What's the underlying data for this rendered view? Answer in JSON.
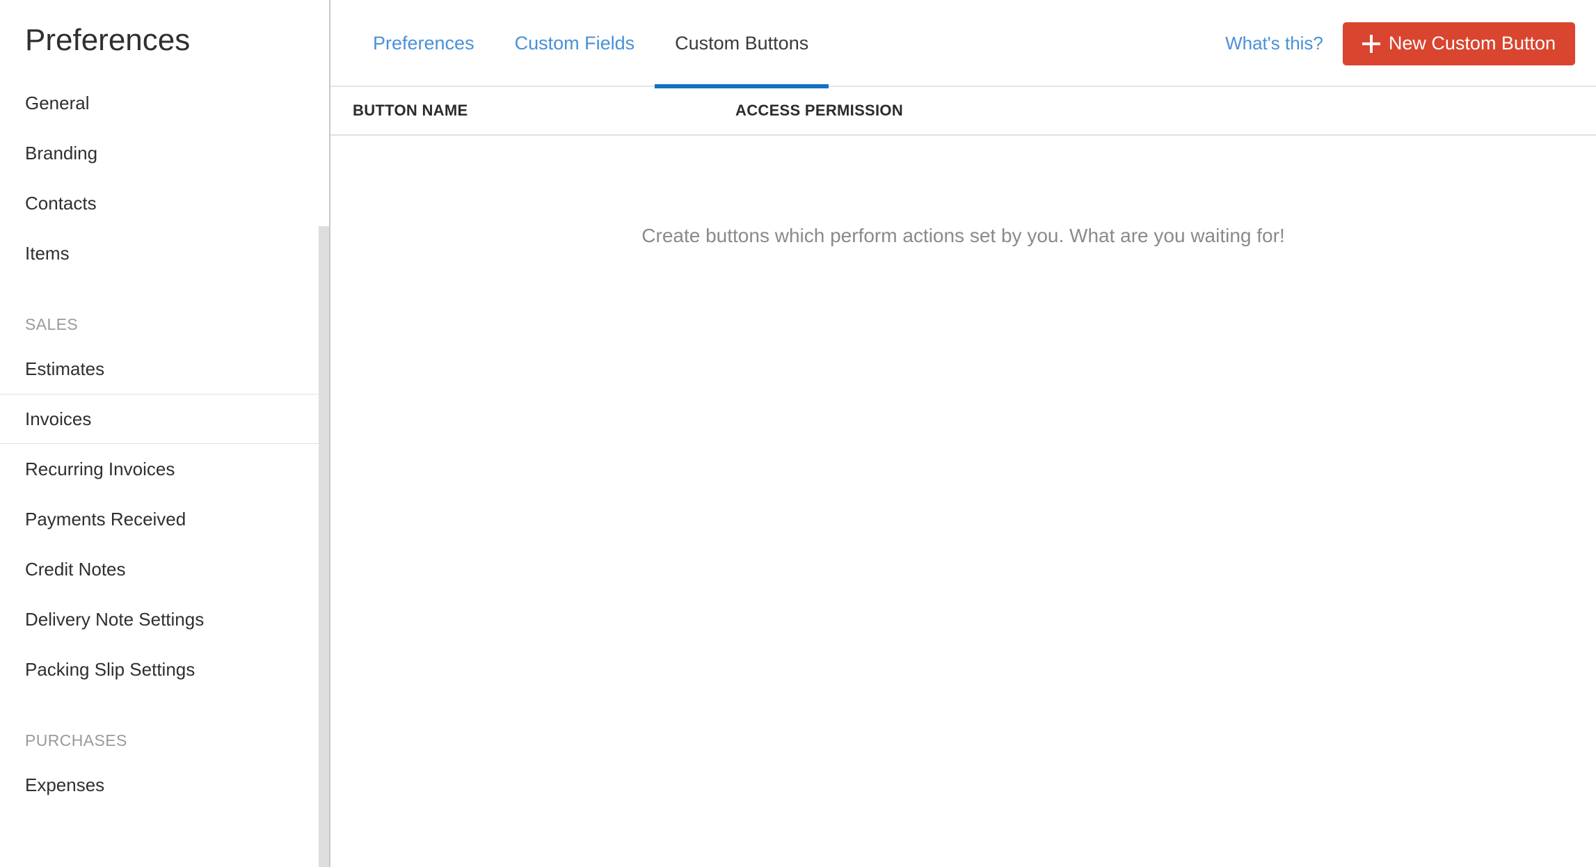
{
  "sidebar": {
    "title": "Preferences",
    "items": [
      {
        "type": "item",
        "label": "General",
        "active": false
      },
      {
        "type": "item",
        "label": "Branding",
        "active": false
      },
      {
        "type": "item",
        "label": "Contacts",
        "active": false
      },
      {
        "type": "item",
        "label": "Items",
        "active": false
      },
      {
        "type": "section",
        "label": "SALES"
      },
      {
        "type": "item",
        "label": "Estimates",
        "active": false
      },
      {
        "type": "item",
        "label": "Invoices",
        "active": true
      },
      {
        "type": "item",
        "label": "Recurring Invoices",
        "active": false
      },
      {
        "type": "item",
        "label": "Payments Received",
        "active": false
      },
      {
        "type": "item",
        "label": "Credit Notes",
        "active": false
      },
      {
        "type": "item",
        "label": "Delivery Note Settings",
        "active": false
      },
      {
        "type": "item",
        "label": "Packing Slip Settings",
        "active": false
      },
      {
        "type": "section",
        "label": "PURCHASES"
      },
      {
        "type": "item",
        "label": "Expenses",
        "active": false
      }
    ]
  },
  "topbar": {
    "tabs": [
      {
        "label": "Preferences",
        "active": false
      },
      {
        "label": "Custom Fields",
        "active": false
      },
      {
        "label": "Custom Buttons",
        "active": true
      }
    ],
    "whats_this_label": "What's this?",
    "new_button_label": "New Custom Button",
    "new_button_icon": "plus-icon"
  },
  "table": {
    "columns": [
      {
        "key": "button_name",
        "label": "BUTTON NAME"
      },
      {
        "key": "access_permission",
        "label": "ACCESS PERMISSION"
      }
    ],
    "rows": [],
    "empty_message": "Create buttons which perform actions set by you. What are you waiting for!"
  },
  "colors": {
    "accent_blue": "#1272c4",
    "link_blue": "#4a90d9",
    "primary_red": "#d9452f",
    "text_dark": "#2f2f2f",
    "text_muted": "#8a8a8a",
    "border_gray": "#e2e2e2"
  }
}
